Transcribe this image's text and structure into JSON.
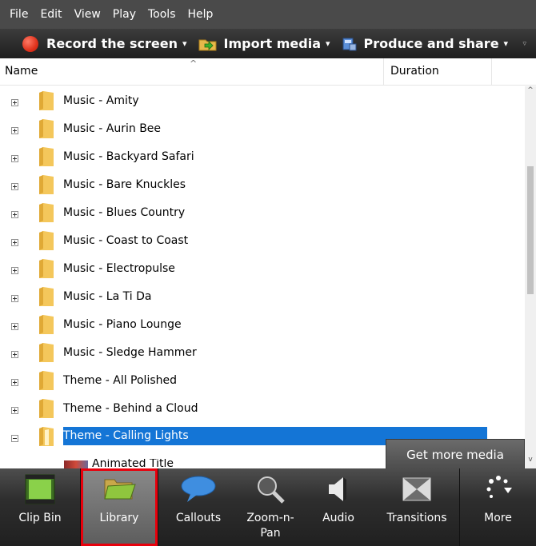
{
  "menubar": {
    "items": [
      "File",
      "Edit",
      "View",
      "Play",
      "Tools",
      "Help"
    ]
  },
  "toolbar": {
    "record_label": "Record the screen",
    "import_label": "Import media",
    "produce_label": "Produce and share",
    "dropdown_glyph": "▾",
    "overflow_glyph": "▿",
    "record_icon": "record-dot-icon",
    "import_icon": "import-folder-icon",
    "produce_icon": "produce-film-icon"
  },
  "columns": {
    "name": "Name",
    "duration": "Duration",
    "sort_glyph": "^"
  },
  "rows": [
    {
      "label": "Music - Amity",
      "expanded": false
    },
    {
      "label": "Music - Aurin Bee",
      "expanded": false
    },
    {
      "label": "Music - Backyard Safari",
      "expanded": false
    },
    {
      "label": "Music - Bare Knuckles",
      "expanded": false
    },
    {
      "label": "Music - Blues Country",
      "expanded": false
    },
    {
      "label": "Music - Coast to Coast",
      "expanded": false
    },
    {
      "label": "Music - Electropulse",
      "expanded": false
    },
    {
      "label": "Music - La Ti Da",
      "expanded": false
    },
    {
      "label": "Music - Piano Lounge",
      "expanded": false
    },
    {
      "label": "Music - Sledge Hammer",
      "expanded": false
    },
    {
      "label": "Theme - All Polished",
      "expanded": false
    },
    {
      "label": "Theme - Behind a Cloud",
      "expanded": false
    },
    {
      "label": "Theme - Calling Lights",
      "expanded": true,
      "selected": true
    }
  ],
  "child_item": {
    "label": "Animated Title"
  },
  "scrollbar": {
    "up_glyph": "^",
    "down_glyph": "v"
  },
  "get_more_media": "Get more media",
  "tabs": [
    {
      "label": "Clip Bin",
      "icon": "film-strip-icon"
    },
    {
      "label": "Library",
      "icon": "library-folder-icon",
      "active": true
    },
    {
      "label": "Callouts",
      "icon": "callout-bubble-icon"
    },
    {
      "label": "Zoom-n-Pan",
      "icon": "magnifier-icon"
    },
    {
      "label": "Audio",
      "icon": "speaker-icon"
    },
    {
      "label": "Transitions",
      "icon": "transitions-icon"
    },
    {
      "label": "More",
      "icon": "more-dots-icon"
    }
  ],
  "colors": {
    "selection": "#1475d6",
    "highlight_border": "#e8000c",
    "menubar_bg": "#4a4a4a",
    "tabbar_bg": "#2e2e2e"
  }
}
